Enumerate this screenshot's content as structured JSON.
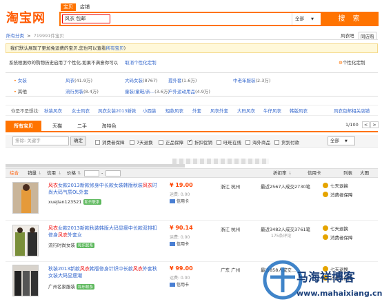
{
  "logo_text": "淘宝网",
  "search": {
    "tabs": [
      "宝贝",
      "店铺"
    ],
    "query": "风衣 包邮",
    "scope": "全部",
    "button": "搜 索"
  },
  "breadcrumb": {
    "root": "所有分类",
    "sep": ">",
    "count": "719991件宝贝"
  },
  "top_links": [
    "风衣吧",
    "同店购"
  ],
  "notice": {
    "text": "我们默认展现了更加免运费的宝贝,您也可以查看",
    "link": "所有宝贝",
    "close": ")"
  },
  "personalize": {
    "text": "系统根据你的购物历史启用了个性化,如果不满意你可以",
    "link": "取消个性化定制",
    "setting": "个性化定制"
  },
  "categories": [
    {
      "label": "女装",
      "items": [
        {
          "name": "风衣",
          "count": "(41.9万)"
        },
        {
          "name": "大码女装",
          "count": "(8767)"
        },
        {
          "name": "提外套",
          "count": "(1.6万)"
        },
        {
          "name": "中老年服装",
          "count": "(2.3万)"
        }
      ]
    },
    {
      "label": "其他",
      "items": [
        {
          "name": "流行男装",
          "count": "(8.4万)"
        },
        {
          "name": "童装/童鞋/亲...",
          "count": "(3.6万)"
        },
        {
          "name": "户外运动用品",
          "count": "(4.9万)"
        }
      ]
    }
  ],
  "suggest": {
    "label": "你是不是想找:",
    "items": [
      "秋装风衣",
      "女士风衣",
      "风衣女装2013新款",
      "小西装",
      "短款风衣",
      "外套",
      "风衣外套",
      "大码风衣",
      "牛仔风衣",
      "韩版风衣"
    ],
    "right": "风衣包邮相关店铺"
  },
  "tabs": [
    "所有宝贝",
    "天猫",
    "二手",
    "淘特色"
  ],
  "pager": {
    "text": "1/100",
    "prev": "<",
    "next": ">"
  },
  "filter": {
    "keyword_placeholder": "排除: 关键字",
    "confirm": "确定",
    "checks": [
      {
        "label": "消费者保障",
        "checked": false
      },
      {
        "label": "7天退换",
        "checked": false
      },
      {
        "label": "正品保障",
        "checked": false
      },
      {
        "label": "折扣促销",
        "checked": true
      },
      {
        "label": "旺旺在线",
        "checked": false
      },
      {
        "label": "海外商品",
        "checked": false
      },
      {
        "label": "货到付款",
        "checked": false
      }
    ],
    "all": "全部"
  },
  "sort": {
    "items": [
      "综合",
      "销量",
      "信用",
      "价格",
      "-"
    ],
    "right": [
      "折扣率",
      "信用卡",
      "列表",
      "大图"
    ]
  },
  "products": [
    {
      "title": [
        {
          "t": "风衣",
          "h": true
        },
        {
          "t": "女款2013新款修身中长款女装韩版秋装",
          "h": false
        },
        {
          "t": "风衣",
          "h": true
        },
        {
          "t": "时尚大码气质OL外套",
          "h": false
        }
      ],
      "seller": "xuejian123521",
      "badge": "和乐联系",
      "price": "¥ 19.00",
      "shipping": "运费: 0.00",
      "card": "信用卡",
      "location": "浙江 杭州",
      "sold": "最近2567人成交2730笔",
      "reviews": "",
      "services": [
        {
          "name": "七天退换",
          "color": "#e5a400"
        },
        {
          "name": "消费者保障",
          "color": "#e5a400"
        }
      ]
    },
    {
      "title": [
        {
          "t": "风衣",
          "h": true
        },
        {
          "t": "女款2013新款秋装韩版大码显瘦中长款双排扣修身",
          "h": false
        },
        {
          "t": "风衣",
          "h": true
        },
        {
          "t": "外套女",
          "h": false
        }
      ],
      "seller": "流行时尚女装",
      "badge": "和乐联系",
      "price": "¥ 90.14",
      "shipping": "运费: 0.00",
      "card": "信用卡",
      "location": "浙江 杭州",
      "sold": "最近3482人成交3761笔",
      "reviews": "175条评论",
      "services": [
        {
          "name": "七天退换",
          "color": "#e5a400"
        },
        {
          "name": "消费者保障",
          "color": "#e5a400"
        }
      ]
    },
    {
      "title": [
        {
          "t": "秋装2013新款",
          "h": false
        },
        {
          "t": "风衣",
          "h": true
        },
        {
          "t": "韩版修身针织中长款",
          "h": false
        },
        {
          "t": "风衣",
          "h": true
        },
        {
          "t": "外套秋女装大码显瘦潮",
          "h": false
        }
      ],
      "seller": "广州名家服装",
      "badge": "和乐联系",
      "price": "¥ 99.00",
      "shipping": "运费: 0.00",
      "card": "信用卡",
      "location": "广东 广州",
      "sold": "最近858人成交...",
      "reviews": "",
      "services": [
        {
          "name": "七天退换",
          "color": "#e5a400"
        },
        {
          "name": "消费者保障",
          "color": "#e5a400"
        }
      ]
    }
  ],
  "watermark": {
    "cn": "马海祥博客",
    "url": "www.mahaixiang.cn"
  }
}
